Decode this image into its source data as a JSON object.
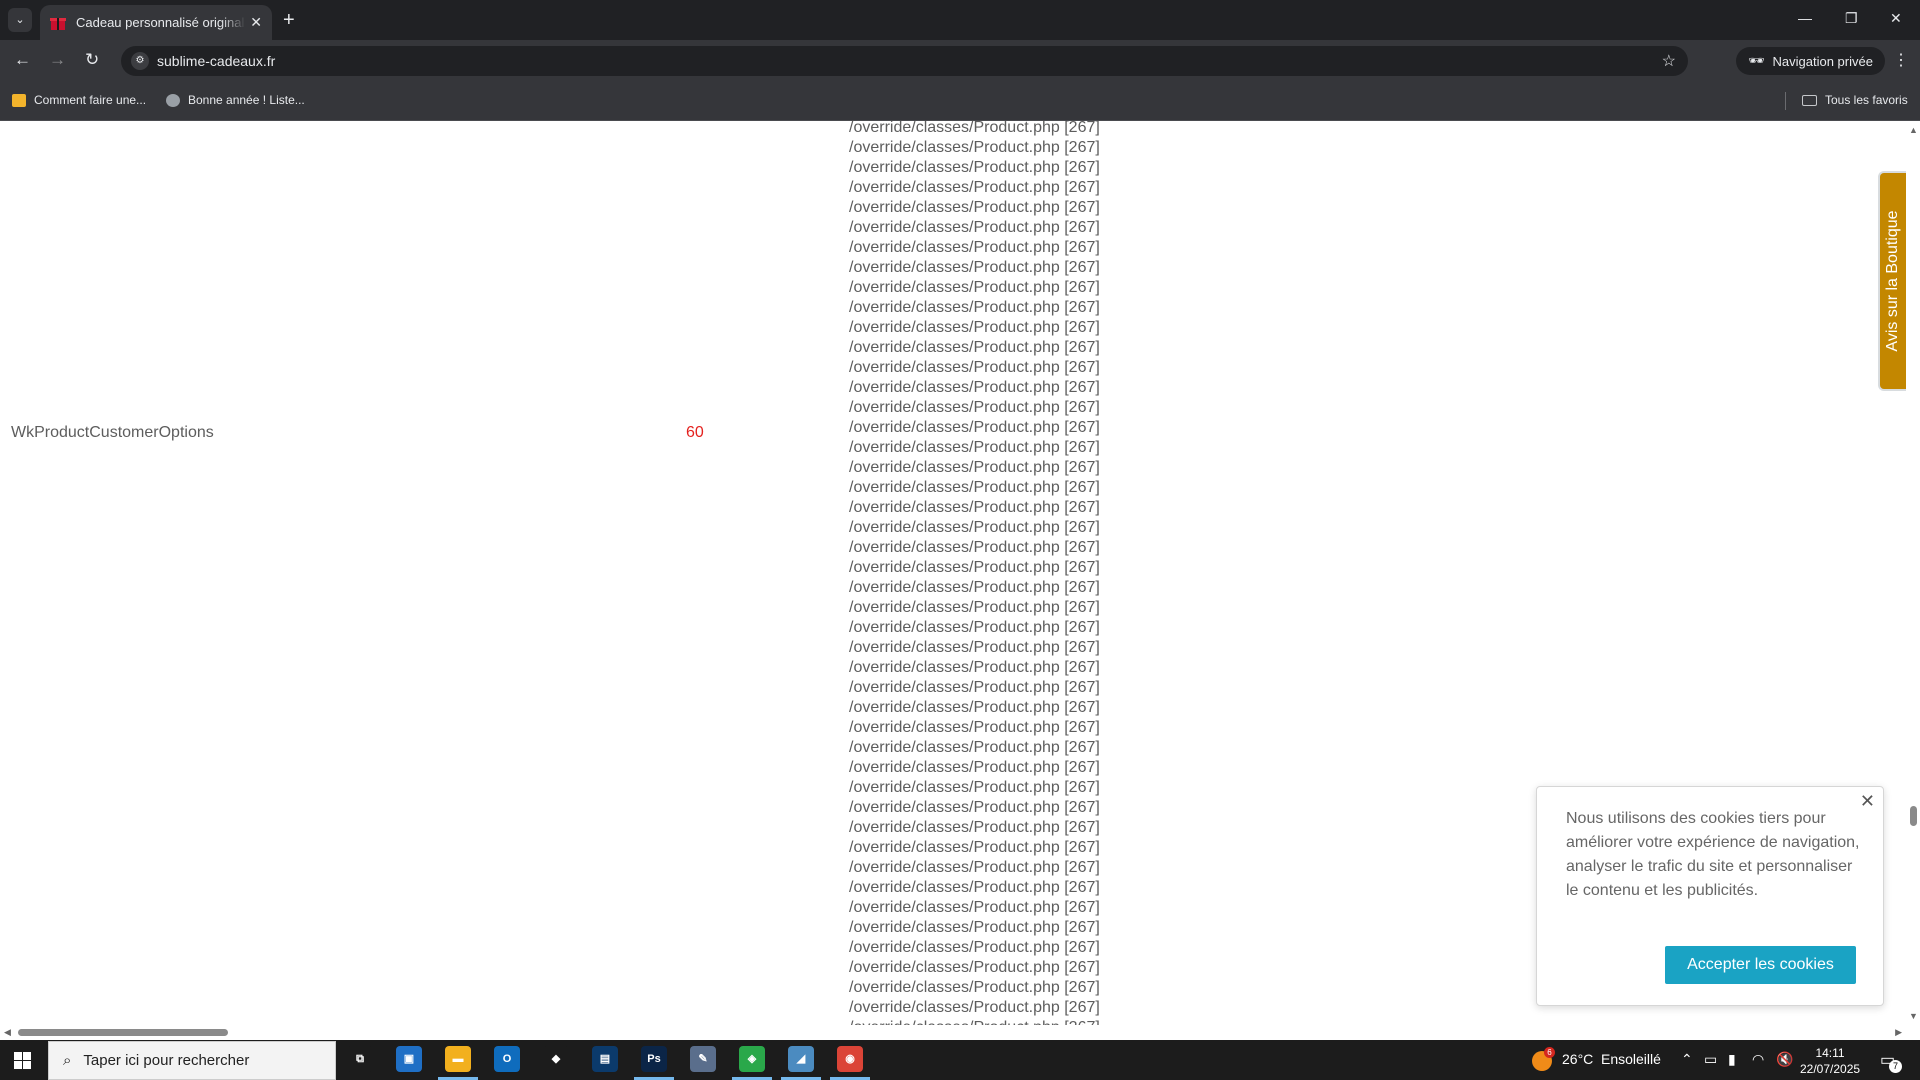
{
  "browser": {
    "tab_title": "Cadeau personnalisé original pour",
    "tab_close": "✕",
    "new_tab": "+",
    "url": "sublime-cadeaux.fr",
    "incognito_label": "Navigation privée",
    "bookmarks": [
      {
        "label": "Comment faire une...",
        "color": "#f3b42c"
      },
      {
        "label": "Bonne année ! Liste...",
        "color": "#9aa0a6"
      }
    ],
    "all_bookmarks": "Tous les favoris"
  },
  "page": {
    "path_line": "/override/classes/Product.php [267]",
    "path_count": 46,
    "module_name": "WkProductCustomerOptions",
    "module_count": "60",
    "avis_label": "Avis sur la Boutique",
    "cookie": {
      "text": "Nous utilisons des cookies tiers pour améliorer votre expérience de navigation, analyser le trafic du site et personnaliser le contenu et les publicités.",
      "accept_label": "Accepter les cookies",
      "close": "✕"
    },
    "colors": {
      "accent": "#1aa3c4",
      "avis": "#c38700",
      "count": "#e4221f"
    }
  },
  "taskbar": {
    "search_placeholder": "Taper ici pour rechercher",
    "apps": [
      {
        "name": "task-view",
        "label": "⧉",
        "color": "#1c1c1c"
      },
      {
        "name": "microsoft-store",
        "label": "▣",
        "color": "#1f6fc5"
      },
      {
        "name": "file-explorer",
        "label": "▬",
        "color": "#f2b01e"
      },
      {
        "name": "outlook",
        "label": "O",
        "color": "#0f6cbd"
      },
      {
        "name": "dropbox",
        "label": "◆",
        "color": "#1c1c1c"
      },
      {
        "name": "notebook",
        "label": "▤",
        "color": "#0b3a6b"
      },
      {
        "name": "photoshop",
        "label": "Ps",
        "color": "#0b2547"
      },
      {
        "name": "paint",
        "label": "✎",
        "color": "#5a6e8c"
      },
      {
        "name": "green-app",
        "label": "◈",
        "color": "#2aa84a"
      },
      {
        "name": "blue-app",
        "label": "◢",
        "color": "#4b8bc0"
      },
      {
        "name": "chrome",
        "label": "◉",
        "color": "#db4437"
      }
    ],
    "weather": {
      "temp": "26°C",
      "condition": "Ensoleillé",
      "badge": "6"
    },
    "time": "14:11",
    "date": "22/07/2025",
    "notification_count": "7"
  }
}
